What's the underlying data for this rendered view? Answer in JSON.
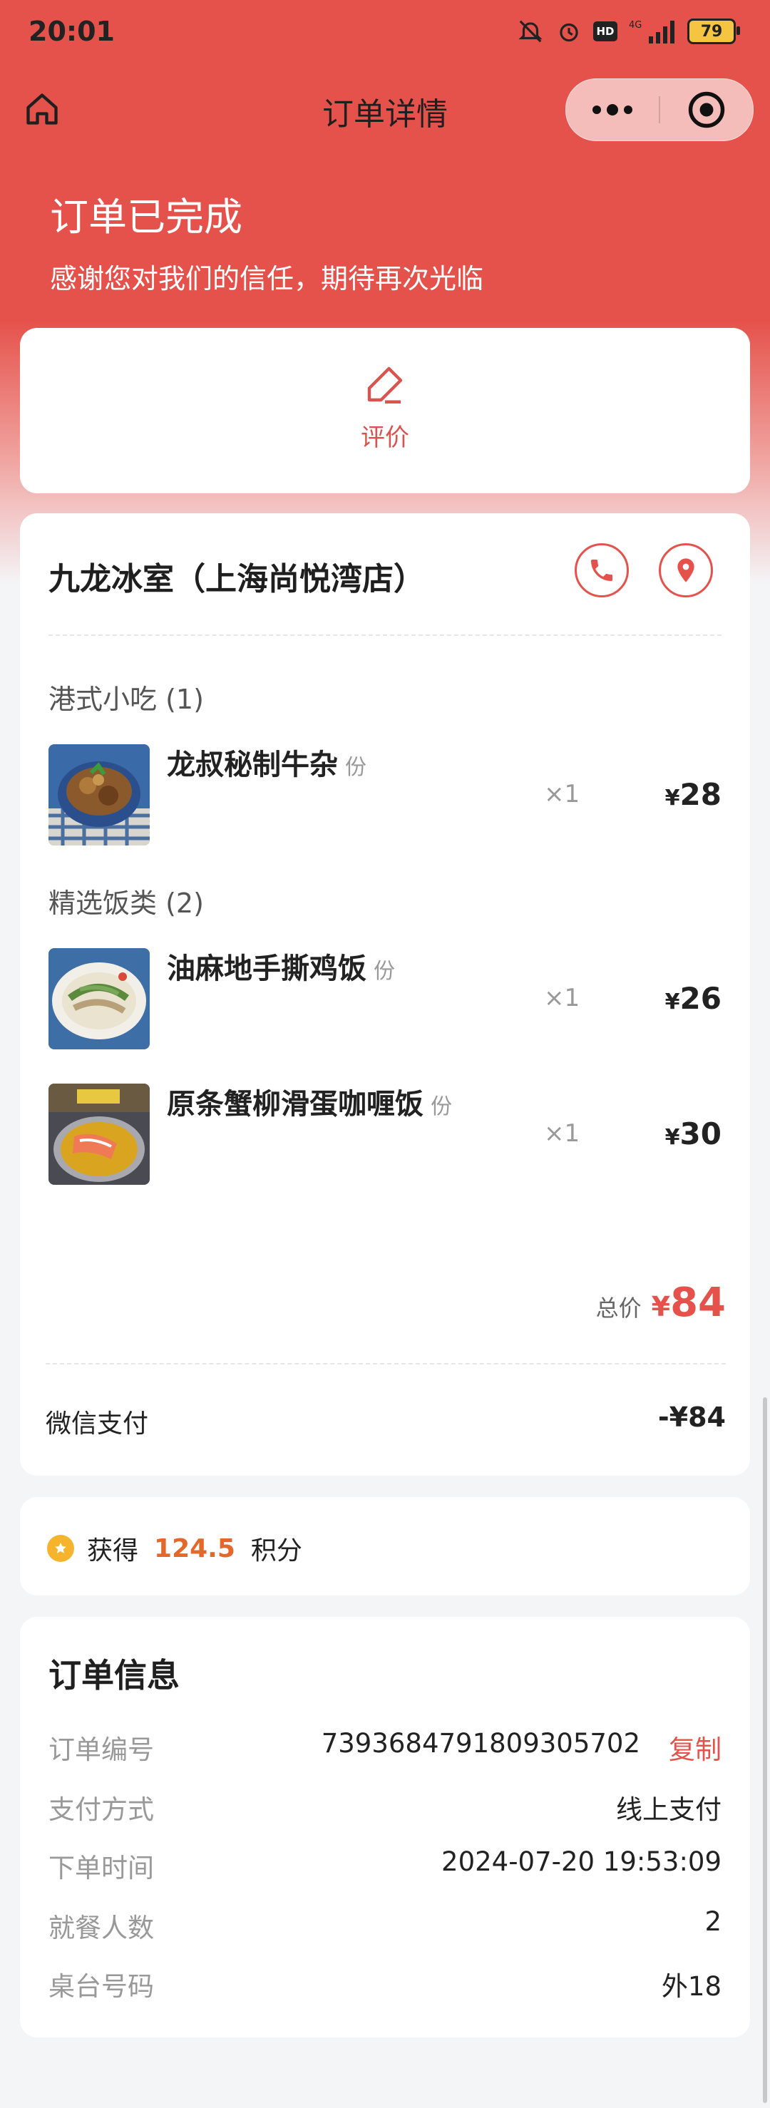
{
  "status_bar": {
    "time": "20:01",
    "signal_label": "4G",
    "hd_label": "HD",
    "battery": "79"
  },
  "nav": {
    "title": "订单详情"
  },
  "order": {
    "status": "订单已完成",
    "subtitle": "感谢您对我们的信任，期待再次光临"
  },
  "review": {
    "label": "评价"
  },
  "shop": {
    "name": "九龙冰室（上海尚悦湾店）",
    "groups": [
      {
        "title": "港式小吃 (1)",
        "items": [
          {
            "name": "龙叔秘制牛杂",
            "unit": "份",
            "qty": "×1",
            "yen": "¥",
            "price": "28"
          }
        ]
      },
      {
        "title": "精选饭类 (2)",
        "items": [
          {
            "name": "油麻地手撕鸡饭",
            "unit": "份",
            "qty": "×1",
            "yen": "¥",
            "price": "26"
          },
          {
            "name": "原条蟹柳滑蛋咖喱饭",
            "unit": "份",
            "qty": "×1",
            "yen": "¥",
            "price": "30"
          }
        ]
      }
    ],
    "total_label": "总价",
    "total_yen": "¥",
    "total_value": "84",
    "payment_label": "微信支付",
    "payment_value": "-¥84"
  },
  "points": {
    "prefix": "获得",
    "value": "124.5",
    "suffix": "积分"
  },
  "order_info": {
    "title": "订单信息",
    "order_no_label": "订单编号",
    "order_no_value": "7393684791809305702",
    "copy_label": "复制",
    "pay_method_label": "支付方式",
    "pay_method_value": "线上支付",
    "order_time_label": "下单时间",
    "order_time_value": "2024-07-20 19:53:09",
    "diners_label": "就餐人数",
    "diners_value": "2",
    "table_label": "桌台号码",
    "table_value": "外18"
  },
  "colors": {
    "brand": "#e5524b",
    "points": "#e2692a",
    "coin": "#f5b42c"
  },
  "icons": [
    "home-icon",
    "more-icon",
    "target-icon",
    "edit-icon",
    "phone-icon",
    "location-icon",
    "star-coin-icon"
  ]
}
